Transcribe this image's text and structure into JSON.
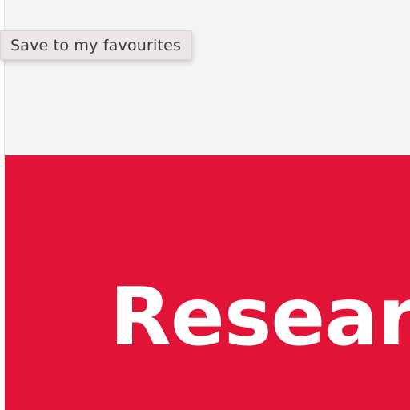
{
  "tooltip": {
    "label": "Save to my favourites"
  },
  "hero": {
    "title": "Researc",
    "background_color": "#e11336",
    "text_color": "#ffffff"
  },
  "page": {
    "background_color": "#f4f4f4"
  }
}
